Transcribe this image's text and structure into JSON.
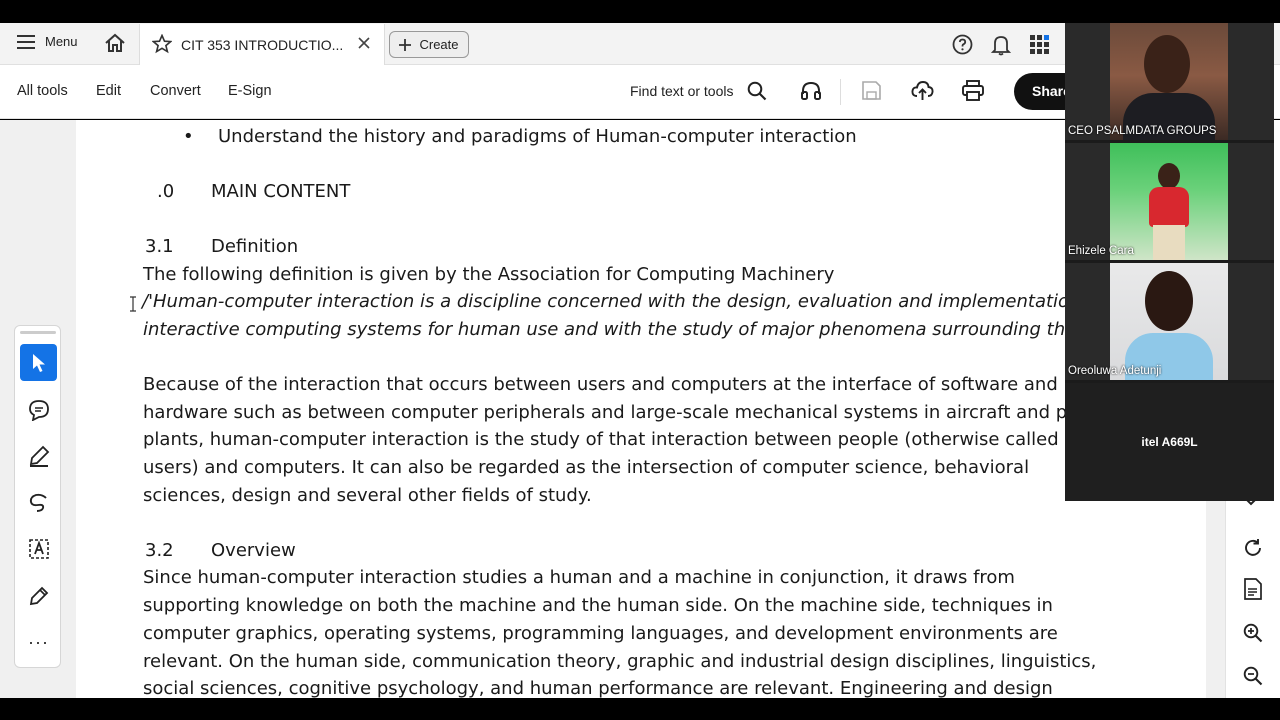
{
  "topbar": {
    "menu_label": "Menu",
    "tab_title": "CIT 353  INTRODUCTIO...",
    "create_label": "Create"
  },
  "toolbar": {
    "all_tools": "All tools",
    "edit": "Edit",
    "convert": "Convert",
    "esign": "E-Sign",
    "find": "Find text or tools",
    "share": "Share"
  },
  "document": {
    "bullet": "Understand the history and paradigms of Human-computer interaction",
    "main_num": ".0",
    "main_heading": "MAIN CONTENT",
    "s31_num": "3.1",
    "s31_title": "Definition",
    "def_intro": "The following definition is given by the Association for Computing Machinery",
    "quote_line1": "/'Human-computer interaction is a discipline concerned with the design, evaluation and implementation of",
    "quote_line2": "interactive computing systems for human use and with the study of major phenomena surrounding them.'",
    "para1_line1": "Because of the interaction that occurs between users and computers at the interface of software and",
    "para1_line2": "hardware such as between computer peripherals and large-scale mechanical systems in aircraft and power",
    "para1_line3": "plants, human-computer interaction is the study of that interaction between people (otherwise called",
    "para1_line4": "users) and computers. It can also be regarded as the intersection of computer science, behavioral",
    "para1_line5": "sciences, design and several other fields of study.",
    "s32_num": "3.2",
    "s32_title": "Overview",
    "para2_line1": "Since human-computer interaction studies a human and a machine in conjunction, it draws from",
    "para2_line2": "supporting knowledge on both the machine and the human side. On the machine side, techniques in",
    "para2_line3": "computer graphics, operating systems, programming languages, and development environments are",
    "para2_line4": "relevant. On the human side, communication theory, graphic and industrial design disciplines, linguistics,",
    "para2_line5": "social sciences, cognitive psychology, and human performance are relevant. Engineering and design"
  },
  "video": {
    "participants": [
      {
        "name": "CEO PSALMDATA GROUPS"
      },
      {
        "name": "Ehizele Cara"
      },
      {
        "name": "Oreoluwa Adetunji"
      },
      {
        "name": "itel A669L"
      }
    ]
  },
  "colors": {
    "accent": "#1473e6",
    "share_bg": "#111111",
    "page_bg": "#ffffff",
    "viewer_bg": "#f0f0f0"
  },
  "icons": [
    "hamburger-icon",
    "home-icon",
    "star-icon",
    "close-icon",
    "plus-icon",
    "help-icon",
    "bell-icon",
    "apps-icon",
    "search-icon",
    "headphones-icon",
    "save-icon",
    "upload-icon",
    "print-icon",
    "select-icon",
    "comment-icon",
    "highlight-icon",
    "draw-icon",
    "textbox-icon",
    "sign-icon",
    "more-icon",
    "refresh-icon",
    "doc-info-icon",
    "zoom-in-icon",
    "zoom-out-icon"
  ]
}
